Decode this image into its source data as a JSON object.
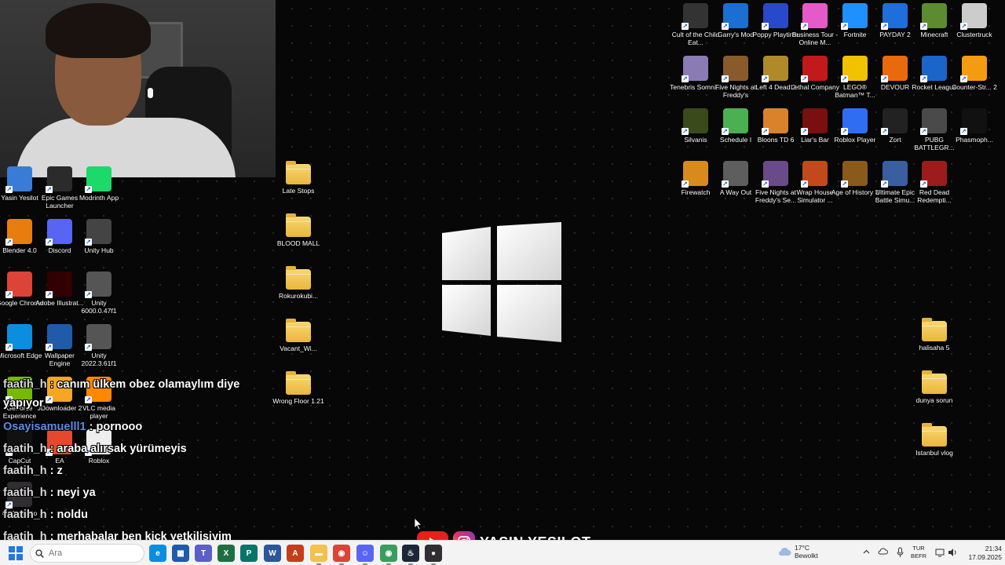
{
  "desktop": {
    "icons_left": [
      {
        "label": "Yasin Yesilot",
        "icon": "user-folder-icon",
        "color": "#3a7bd5"
      },
      {
        "label": "Epic Games Launcher",
        "icon": "epic-games-icon",
        "color": "#2b2b2b"
      },
      {
        "label": "Modrinth App",
        "icon": "modrinth-icon",
        "color": "#1bd96a"
      },
      {
        "label": "Blender 4.0",
        "icon": "blender-icon",
        "color": "#e87d0d"
      },
      {
        "label": "Discord",
        "icon": "discord-icon",
        "color": "#5865f2"
      },
      {
        "label": "Unity Hub",
        "icon": "unity-hub-icon",
        "color": "#444444"
      },
      {
        "label": "Google Chrome",
        "icon": "chrome-icon",
        "color": "#db4437"
      },
      {
        "label": "Adobe Illustrat...",
        "icon": "illustrator-icon",
        "color": "#330000"
      },
      {
        "label": "Unity 6000.0.47f1",
        "icon": "unity-icon",
        "color": "#555555"
      },
      {
        "label": "Microsoft Edge",
        "icon": "edge-icon",
        "color": "#0c8ee0"
      },
      {
        "label": "Wallpaper Engine",
        "icon": "wallpaper-engine-icon",
        "color": "#1f5ba8"
      },
      {
        "label": "Unity 2022.3.61f1",
        "icon": "unity-icon",
        "color": "#555555"
      },
      {
        "label": "GeForce Experience",
        "icon": "geforce-icon",
        "color": "#76b900"
      },
      {
        "label": "JDownloader 2",
        "icon": "jdownloader-icon",
        "color": "#f5a623"
      },
      {
        "label": "VLC media player",
        "icon": "vlc-icon",
        "color": "#ff8800"
      },
      {
        "label": "CapCut",
        "icon": "capcut-icon",
        "color": "#111111"
      },
      {
        "label": "EA",
        "icon": "ea-icon",
        "color": "#e4492e"
      },
      {
        "label": "Roblox",
        "icon": "roblox-icon",
        "color": "#eeeeee"
      },
      {
        "label": "OBS Studio",
        "icon": "obs-icon",
        "color": "#302e31"
      }
    ],
    "folders_middle": [
      {
        "label": "Late Stops"
      },
      {
        "label": "BLOOD MALL"
      },
      {
        "label": "Rokurokubi..."
      },
      {
        "label": "Vacant_Wi..."
      },
      {
        "label": "Wrong Floor 1.21"
      }
    ],
    "icons_right": [
      {
        "label": "Cult of the Child Eat...",
        "icon": "cult-icon",
        "color": "#333333"
      },
      {
        "label": "Garry's Mod",
        "icon": "gmod-icon",
        "color": "#1a6fd1"
      },
      {
        "label": "Poppy Playtime",
        "icon": "poppy-icon",
        "color": "#2849c9"
      },
      {
        "label": "Business Tour - Online M...",
        "icon": "business-tour-icon",
        "color": "#e45ac8"
      },
      {
        "label": "Fortnite",
        "icon": "fortnite-icon",
        "color": "#1e90ff"
      },
      {
        "label": "PAYDAY 2",
        "icon": "payday-icon",
        "color": "#1e6fd9"
      },
      {
        "label": "Minecraft",
        "icon": "minecraft-icon",
        "color": "#5c8c2f"
      },
      {
        "label": "Clustertruck",
        "icon": "clustertruck-icon",
        "color": "#cccccc"
      },
      {
        "label": "Tenebris Somni...",
        "icon": "tenebris-icon",
        "color": "#8a7bb4"
      },
      {
        "label": "Five Nights at Freddy's",
        "icon": "fnaf-icon",
        "color": "#8b5a2b"
      },
      {
        "label": "Left 4 Dead 2",
        "icon": "l4d2-icon",
        "color": "#b08a2a"
      },
      {
        "label": "Lethal Company",
        "icon": "lethal-company-icon",
        "color": "#c21a1a"
      },
      {
        "label": "LEGO® Batman™ T...",
        "icon": "lego-batman-icon",
        "color": "#f2c100"
      },
      {
        "label": "DEVOUR",
        "icon": "devour-icon",
        "color": "#e86a0c"
      },
      {
        "label": "Rocket League",
        "icon": "rocket-league-icon",
        "color": "#1c64c9"
      },
      {
        "label": "Counter-Str... 2",
        "icon": "cs2-icon",
        "color": "#f39c12"
      },
      {
        "label": "Silvanis",
        "icon": "silvanis-icon",
        "color": "#3a4a1a"
      },
      {
        "label": "Schedule I",
        "icon": "schedule-icon",
        "color": "#4caf50"
      },
      {
        "label": "Bloons TD 6",
        "icon": "bloons-icon",
        "color": "#d9822b"
      },
      {
        "label": "Liar's Bar",
        "icon": "liars-bar-icon",
        "color": "#7a0f0f"
      },
      {
        "label": "Roblox Player",
        "icon": "roblox-player-icon",
        "color": "#2f6ef2"
      },
      {
        "label": "Zort",
        "icon": "zort-icon",
        "color": "#222222"
      },
      {
        "label": "PUBG BATTLEGR...",
        "icon": "pubg-icon",
        "color": "#4a4a4a"
      },
      {
        "label": "Phasmoph...",
        "icon": "phasmophobia-icon",
        "color": "#111111"
      },
      {
        "label": "Firewatch",
        "icon": "firewatch-icon",
        "color": "#d88a1d"
      },
      {
        "label": "A Way Out",
        "icon": "a-way-out-icon",
        "color": "#5e5e5e"
      },
      {
        "label": "Five Nights at Freddy's Se...",
        "icon": "fnaf-sb-icon",
        "color": "#6b4a8a"
      },
      {
        "label": "Wrap House Simulator ...",
        "icon": "wrap-house-icon",
        "color": "#c24a1a"
      },
      {
        "label": "Age of History 3",
        "icon": "age-of-history-icon",
        "color": "#8a5a1a"
      },
      {
        "label": "Ultimate Epic Battle Simu...",
        "icon": "uebs-icon",
        "color": "#3a5fa0"
      },
      {
        "label": "Red Dead Redempti...",
        "icon": "red-dead-icon",
        "color": "#9e1b1b"
      }
    ],
    "folders_right": [
      {
        "label": "halisaha 5"
      },
      {
        "label": "dunya sorun"
      },
      {
        "label": "Istanbul vlog"
      }
    ]
  },
  "chat": [
    {
      "user": "faatih_h",
      "message": "canım ülkem obez olamaylım diye yapıyor",
      "user_color": "#d7d7d7"
    },
    {
      "user": "Osayisamuelll1",
      "message": "pornooo",
      "user_color": "#5b8ee6"
    },
    {
      "user": "faatih_h",
      "message": "araba alırsak yürümeyis",
      "user_color": "#d7d7d7"
    },
    {
      "user": "faatih_h",
      "message": "z",
      "user_color": "#d7d7d7"
    },
    {
      "user": "faatih_h",
      "message": "neyi ya",
      "user_color": "#d7d7d7"
    },
    {
      "user": "faatih_h",
      "message": "noldu",
      "user_color": "#d7d7d7"
    },
    {
      "user": "faatih_h",
      "message": "merhabalar ben kick yetkilisiyim",
      "user_color": "#d7d7d7"
    }
  ],
  "banner": {
    "text": "YASIN YESILOT"
  },
  "taskbar": {
    "search_placeholder": "Ara",
    "apps": [
      {
        "icon": "edge-icon",
        "color": "#0c8ee0",
        "glyph": "e"
      },
      {
        "icon": "store-icon",
        "color": "#1f5ba8",
        "glyph": "▦"
      },
      {
        "icon": "teams-icon",
        "color": "#5b5fc7",
        "glyph": "T"
      },
      {
        "icon": "excel-icon",
        "color": "#1d6f42",
        "glyph": "X"
      },
      {
        "icon": "publisher-icon",
        "color": "#077568",
        "glyph": "P"
      },
      {
        "icon": "word-icon",
        "color": "#2b579a",
        "glyph": "W"
      },
      {
        "icon": "access-icon",
        "color": "#c43e1c",
        "glyph": "A"
      },
      {
        "icon": "file-explorer-icon",
        "color": "#f2c14e",
        "glyph": "▬"
      },
      {
        "icon": "chrome-icon",
        "color": "#db4437",
        "glyph": "◉"
      },
      {
        "icon": "discord-icon",
        "color": "#5865f2",
        "glyph": "☺"
      },
      {
        "icon": "chrome-icon-2",
        "color": "#3a9d5d",
        "glyph": "◉"
      },
      {
        "icon": "steam-icon",
        "color": "#1b2838",
        "glyph": "♨"
      },
      {
        "icon": "obs-icon",
        "color": "#302e31",
        "glyph": "●"
      }
    ],
    "weather": {
      "temp": "17°C",
      "condition": "Bewolkt"
    },
    "language": {
      "line1": "TUR",
      "line2": "BEFR"
    },
    "clock": {
      "time": "21:34",
      "date": "17.09.2025"
    }
  }
}
